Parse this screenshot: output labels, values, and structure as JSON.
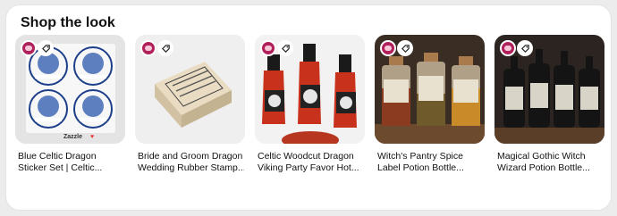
{
  "section": {
    "title": "Shop the look"
  },
  "products": [
    {
      "line1": "Blue Celtic Dragon",
      "line2": "Sticker Set | Celtic...",
      "image_text": "Zazzle",
      "heart": "♥"
    },
    {
      "line1": "Bride and Groom Dragon",
      "line2": "Wedding Rubber Stamp..."
    },
    {
      "line1": "Celtic Woodcut Dragon",
      "line2": "Viking Party Favor Hot..."
    },
    {
      "line1": "Witch's Pantry Spice",
      "line2": "Label Potion Bottle..."
    },
    {
      "line1": "Magical Gothic Witch",
      "line2": "Wizard Potion Bottle..."
    }
  ],
  "icons": {
    "seller_avatar": "seller-avatar",
    "product_tag": "tag-icon"
  }
}
